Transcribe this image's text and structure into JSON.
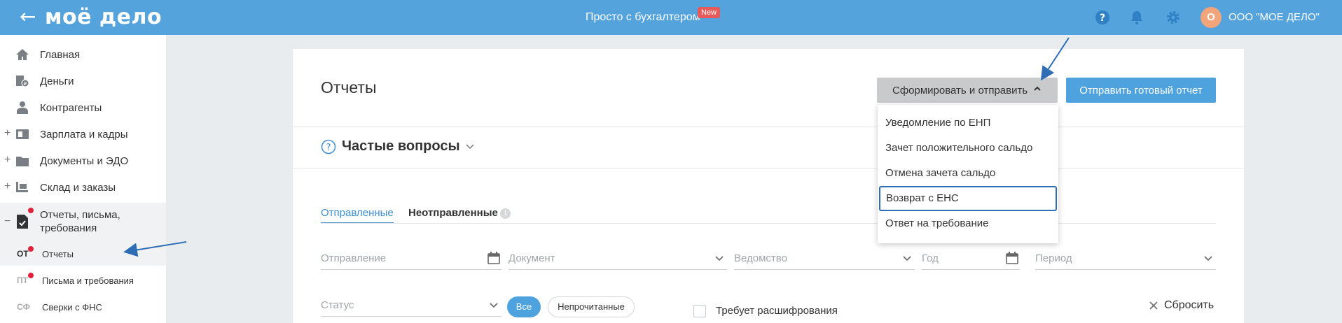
{
  "header": {
    "back_symbol": "←",
    "logo": "моё дело",
    "promo": "Просто с бухгалтером",
    "promo_badge": "New",
    "user_initial": "О",
    "org_name": "ООО \"МОЕ ДЕЛО\""
  },
  "sidebar": {
    "items": [
      {
        "label": "Главная",
        "icon": "home-icon"
      },
      {
        "label": "Деньги",
        "icon": "money-icon"
      },
      {
        "label": "Контрагенты",
        "icon": "contractors-icon"
      },
      {
        "label": "Зарплата и кадры",
        "icon": "salary-icon",
        "toggle": "+"
      },
      {
        "label": "Документы и ЭДО",
        "icon": "folder-icon",
        "toggle": "+"
      },
      {
        "label": "Склад и заказы",
        "icon": "warehouse-icon",
        "toggle": "+"
      },
      {
        "label": "Отчеты, письма,",
        "label2": "требования",
        "icon": "reports-icon",
        "toggle": "−"
      }
    ],
    "subitems": [
      {
        "abbr": "ОТ",
        "label": "Отчеты"
      },
      {
        "abbr": "ПТ",
        "label": "Письма и требования"
      },
      {
        "abbr": "СФ",
        "label": "Сверки с ФНС"
      }
    ]
  },
  "main": {
    "title": "Отчеты",
    "generate_button": "Сформировать и отправить",
    "send_button": "Отправить готовый отчет",
    "faq": "Частые вопросы",
    "tabs": [
      {
        "label": "Отправленные",
        "active": true
      },
      {
        "label": "Неотправленные",
        "count": "1"
      }
    ],
    "filters": {
      "sending": "Отправление",
      "document": "Документ",
      "agency": "Ведомство",
      "year": "Год",
      "period": "Период",
      "status": "Статус",
      "all": "Все",
      "unread": "Непрочитанные",
      "needs_decryption": "Требует расшифрования",
      "reset": "Сбросить"
    }
  },
  "dropdown": {
    "items": [
      "Уведомление по ЕНП",
      "Зачет положительного сальдо",
      "Отмена зачета сальдо",
      "Возврат с ЕНС",
      "Ответ на требование"
    ],
    "focused_index": 3
  },
  "colors": {
    "header_bg": "#55a3dd",
    "accent": "#4ea3df",
    "notification_dot": "#e0223a",
    "annotation_arrow": "#2f6eb5"
  }
}
